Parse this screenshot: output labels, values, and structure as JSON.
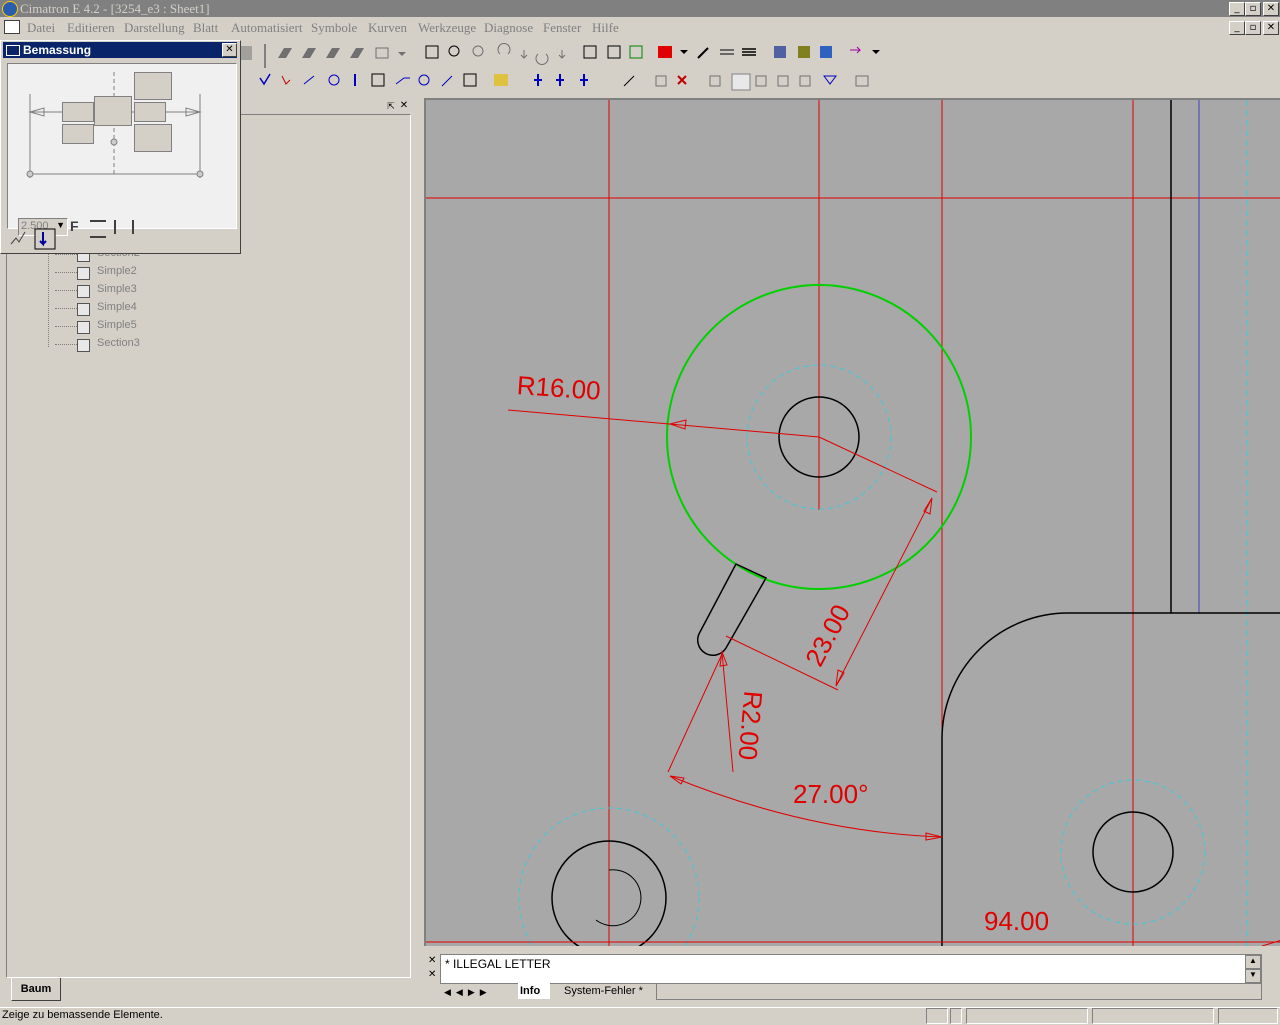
{
  "window": {
    "title": "Cimatron E 4.2 - [3254_e3 : Sheet1]"
  },
  "menu": [
    "Datei",
    "Editieren",
    "Darstellung",
    "Blatt",
    "Automatisiert",
    "Symbole",
    "Kurven",
    "Werkzeuge",
    "Diagnose",
    "Fenster",
    "Hilfe"
  ],
  "dialog": {
    "title": "Bemassung",
    "text_height": "2.500"
  },
  "tree": {
    "items": [
      "Section2",
      "Simple2",
      "Simple3",
      "Simple4",
      "Simple5",
      "Section3"
    ],
    "tab_label": "Baum"
  },
  "drawing": {
    "dim_radius_large": "R16.00",
    "dim_linear": "23.00",
    "dim_radius_small": "R2.00",
    "dim_angle": "27.00°",
    "dim_bottom": "94.00",
    "colors": {
      "background": "#a8a8a8",
      "dimension": "#e00000",
      "highlight_circle": "#00d000",
      "hidden_circle": "#40c8d8",
      "geometry": "#000000",
      "blue_line": "#4040c0"
    }
  },
  "info_panel": {
    "message": "* ILLEGAL LETTER",
    "tabs": [
      "Info",
      "System-Fehler *"
    ]
  },
  "status": {
    "prompt": "Zeige zu bemassende Elemente."
  }
}
